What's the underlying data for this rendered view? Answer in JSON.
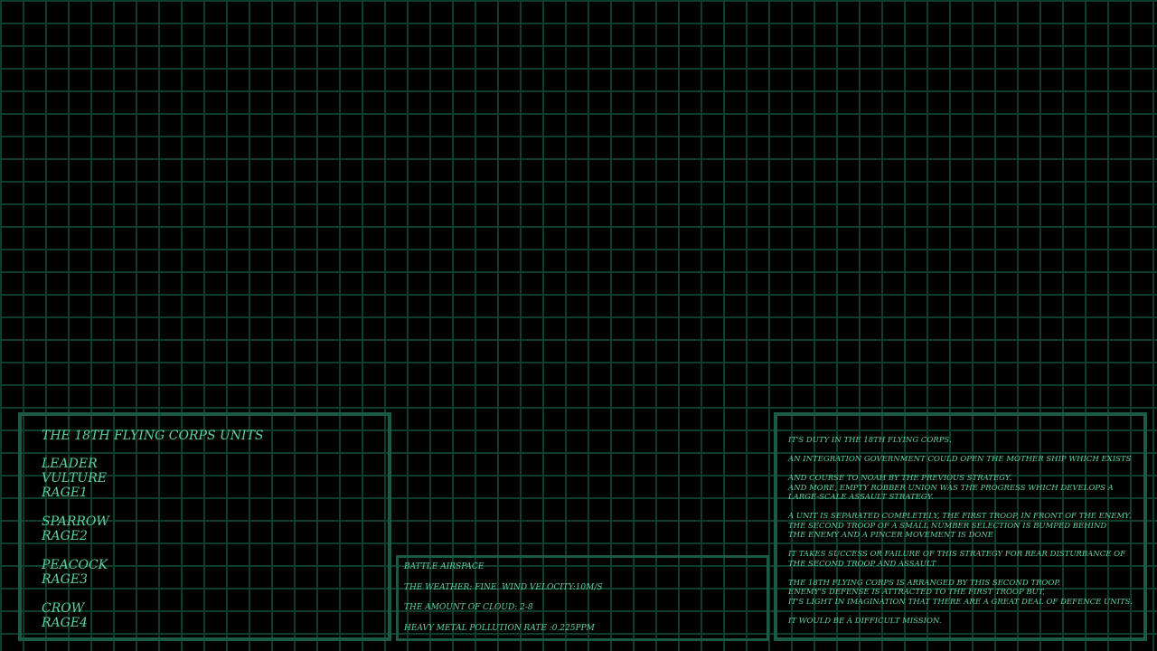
{
  "units_panel": {
    "title": "THE 18TH FLYING CORPS UNITS",
    "groups": [
      {
        "lines": [
          "LEADER",
          "VULTURE",
          "RAGE1"
        ]
      },
      {
        "lines": [
          "SPARROW",
          "RAGE2"
        ]
      },
      {
        "lines": [
          "PEACOCK",
          "RAGE3"
        ]
      },
      {
        "lines": [
          "CROW",
          "RAGE4"
        ]
      }
    ]
  },
  "airspace_panel": {
    "lines": [
      "BATTLE AIRSPACE",
      "THE WEATHER: FINE.  WIND VELOCITY:10M/S",
      "THE AMOUNT OF CLOUD: 2-8",
      "HEAVY METAL POLLUTION RATE :0.225PPM"
    ]
  },
  "briefing_panel": {
    "paragraphs": [
      [
        "IT'S DUTY IN THE 18TH FLYING CORPS."
      ],
      [
        "AN INTEGRATION GOVERNMENT COULD OPEN THE MOTHER SHIP WHICH EXISTS"
      ],
      [
        "AND COURSE TO NOAH BY THE PREVIOUS STRATEGY.",
        "AND MORE, EMPTY ROBBER UNION WAS THE PROGRESS WHICH DEVELOPS A",
        "LARGE-SCALE ASSAULT STRATEGY."
      ],
      [
        "A UNIT IS SEPARATED COMPLETELY, THE FIRST TROOP, IN FRONT OF THE ENEMY.",
        "THE SECOND TROOP OF A SMALL NUMBER SELECTION IS BUMPED BEHIND",
        "THE ENEMY AND A PINCER MOVEMENT IS DONE"
      ],
      [
        "IT TAKES SUCCESS OR FAILURE OF THIS STRATEGY FOR REAR DISTURBANCE OF",
        "THE SECOND TROOP AND ASSAULT"
      ],
      [
        "THE 18TH FLYING CORPS IS ARRANGED BY THIS SECOND TROOP.",
        "ENEMY'S DEFENSE IS ATTRACTED TO THE FIRST TROOP BUT,",
        "IT'S LIGHT IN IMAGINATION THAT THERE ARE A GREAT DEAL OF DEFENCE UNITS."
      ],
      [
        "IT WOULD BE A DIFFICULT MISSION."
      ]
    ]
  }
}
